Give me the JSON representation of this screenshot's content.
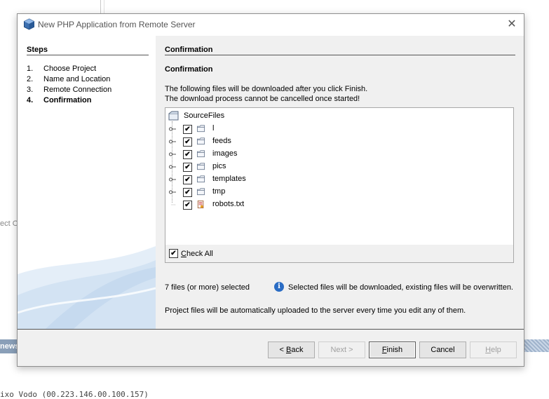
{
  "background": {
    "left_text": "ect O",
    "strip_text": "news",
    "bottom_text": "ixo Vodo (00.223.146.00.100.157)"
  },
  "dialog": {
    "title": "New PHP Application from Remote Server",
    "close_label": "✕"
  },
  "steps": {
    "title": "Steps",
    "items": [
      {
        "num": "1.",
        "label": "Choose Project"
      },
      {
        "num": "2.",
        "label": "Name and Location"
      },
      {
        "num": "3.",
        "label": "Remote Connection"
      },
      {
        "num": "4.",
        "label": "Confirmation"
      }
    ],
    "current_index": 3
  },
  "main": {
    "section_title": "Confirmation",
    "subtitle": "Confirmation",
    "desc_line1": "The following files will be downloaded after you click Finish.",
    "desc_line2": "The download process cannot be cancelled once started!",
    "tree": {
      "root": "SourceFiles",
      "items": [
        {
          "label": "l",
          "type": "folder",
          "checked": true
        },
        {
          "label": "feeds",
          "type": "folder",
          "checked": true
        },
        {
          "label": "images",
          "type": "folder",
          "checked": true
        },
        {
          "label": "pics",
          "type": "folder",
          "checked": true
        },
        {
          "label": "templates",
          "type": "folder",
          "checked": true
        },
        {
          "label": "tmp",
          "type": "folder",
          "checked": true
        },
        {
          "label": "robots.txt",
          "type": "file",
          "checked": true
        }
      ]
    },
    "check_all": {
      "label_first": "C",
      "label_rest": "heck All",
      "checked": true
    },
    "count_text": "7 files (or more) selected",
    "info_text": "Selected files will be downloaded, existing files will be overwritten.",
    "upload_text": "Project files will be automatically uploaded to the server every time you edit any of them."
  },
  "buttons": {
    "back": {
      "pre": "< ",
      "mnemonic": "B",
      "post": "ack"
    },
    "next": "Next >",
    "finish": {
      "mnemonic": "F",
      "post": "inish"
    },
    "cancel": "Cancel",
    "help": {
      "mnemonic": "H",
      "post": "elp"
    }
  },
  "colors": {
    "accent": "#2a6cc4",
    "dialog_bg": "#f0f0f0"
  }
}
